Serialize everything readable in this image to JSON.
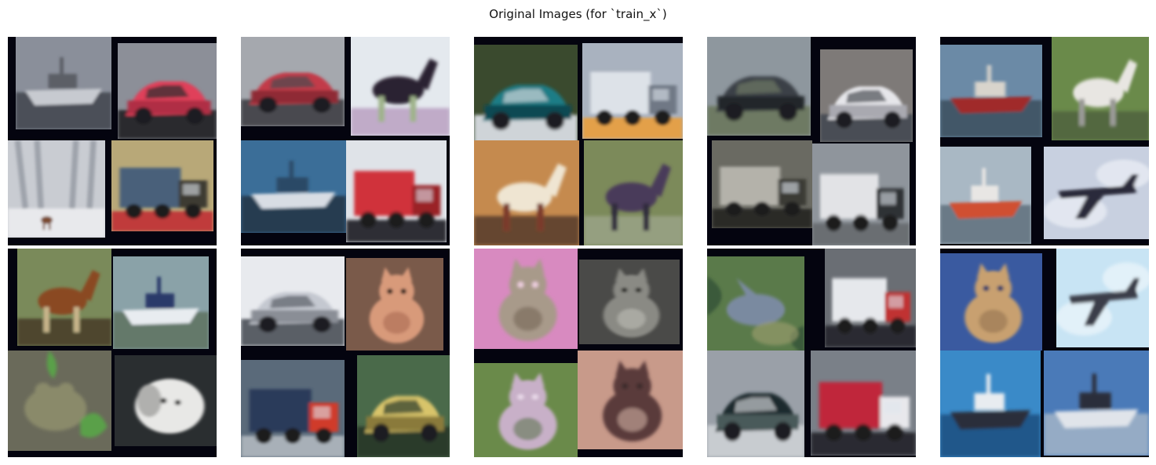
{
  "title": "Original Images (for `train_x`)",
  "grid": {
    "rows": 2,
    "cols": 5
  },
  "mosaics": [
    {
      "name": "mosaic-r1-c1",
      "tiles": [
        {
          "name": "tile-boats-shore",
          "icon": "boat-icon",
          "colors": {
            "bg": "#8a8f9a",
            "a": "#c7cad0",
            "b": "#5b5f66",
            "c": "#3b3f48"
          }
        },
        {
          "name": "tile-red-car",
          "icon": "car-icon",
          "colors": {
            "bg": "#8c8f98",
            "a": "#e0405a",
            "b": "#b02e44",
            "c": "#2a2a2e"
          }
        },
        {
          "name": "tile-deer-snow",
          "icon": "deer-icon",
          "colors": {
            "bg": "#c9ccd2",
            "a": "#9ea3ab",
            "b": "#7a4a2e",
            "c": "#e8e9ec"
          }
        },
        {
          "name": "tile-truck-road",
          "icon": "truck-icon",
          "colors": {
            "bg": "#b8a878",
            "a": "#49617a",
            "b": "#3e3a30",
            "c": "#c03a3a"
          }
        }
      ]
    },
    {
      "name": "mosaic-r1-c2",
      "tiles": [
        {
          "name": "tile-red-car-street",
          "icon": "car-icon",
          "colors": {
            "bg": "#a5a8ae",
            "a": "#c23a48",
            "b": "#8f2a36",
            "c": "#4a4a50"
          }
        },
        {
          "name": "tile-horse-rider",
          "icon": "horse-icon",
          "colors": {
            "bg": "#e4e9ee",
            "a": "#2a2230",
            "b": "#9fb38a",
            "c": "#b090b8"
          }
        },
        {
          "name": "tile-boat-sea",
          "icon": "boat-icon",
          "colors": {
            "bg": "#3b6e98",
            "a": "#d8dde4",
            "b": "#2a4a66",
            "c": "#1e2e3e"
          }
        },
        {
          "name": "tile-fire-truck",
          "icon": "truck-icon",
          "colors": {
            "bg": "#dfe3e8",
            "a": "#d0303a",
            "b": "#9a2026",
            "c": "#2e2e34"
          }
        }
      ]
    },
    {
      "name": "mosaic-r1-c3",
      "tiles": [
        {
          "name": "tile-teal-car",
          "icon": "car-icon",
          "colors": {
            "bg": "#3a4a2e",
            "a": "#1f7d86",
            "b": "#0f4a52",
            "c": "#cfd4d8"
          }
        },
        {
          "name": "tile-truck-closeup",
          "icon": "truck-icon",
          "colors": {
            "bg": "#a9b2bf",
            "a": "#dde2e8",
            "b": "#6f7885",
            "c": "#e3a04a"
          }
        },
        {
          "name": "tile-horse-head",
          "icon": "horse-icon",
          "colors": {
            "bg": "#c58a4e",
            "a": "#efe5d2",
            "b": "#7a3a2a",
            "c": "#3a2a24"
          }
        },
        {
          "name": "tile-dark-horse",
          "icon": "horse-icon",
          "colors": {
            "bg": "#7c8a5a",
            "a": "#4a3a5a",
            "b": "#2e2a3a",
            "c": "#a0a890"
          }
        }
      ]
    },
    {
      "name": "mosaic-r1-c4",
      "tiles": [
        {
          "name": "tile-dark-car",
          "icon": "car-icon",
          "colors": {
            "bg": "#8e979e",
            "a": "#3a3f46",
            "b": "#22252a",
            "c": "#6e7a64"
          }
        },
        {
          "name": "tile-white-car",
          "icon": "car-icon",
          "colors": {
            "bg": "#7e7a78",
            "a": "#e6e6ea",
            "b": "#a9a9b0",
            "c": "#4a4e54"
          }
        },
        {
          "name": "tile-tanker-truck",
          "icon": "truck-icon",
          "colors": {
            "bg": "#6a6a62",
            "a": "#b4b2aa",
            "b": "#3a3a36",
            "c": "#2a2a28"
          }
        },
        {
          "name": "tile-trailer",
          "icon": "trailer-icon",
          "colors": {
            "bg": "#8f959c",
            "a": "#e2e3e6",
            "b": "#2e3034",
            "c": "#6a6e72"
          }
        }
      ]
    },
    {
      "name": "mosaic-r1-c5",
      "tiles": [
        {
          "name": "tile-tug-harbor",
          "icon": "boat-icon",
          "colors": {
            "bg": "#6b8aa6",
            "a": "#a02a2a",
            "b": "#d8d4cc",
            "c": "#3a4a58"
          }
        },
        {
          "name": "tile-white-horse",
          "icon": "horse-icon",
          "colors": {
            "bg": "#6a8a4a",
            "a": "#e8e6e2",
            "b": "#9a9a96",
            "c": "#4a5a3a"
          }
        },
        {
          "name": "tile-red-boat",
          "icon": "boat-icon",
          "colors": {
            "bg": "#a9b8c4",
            "a": "#d05030",
            "b": "#e8e6e4",
            "c": "#5a6a78"
          }
        },
        {
          "name": "tile-airplane-sky",
          "icon": "airplane-icon",
          "colors": {
            "bg": "#c8d0e0",
            "a": "#2a2c3a",
            "b": "#e8ecf4",
            "c": "#7a8aa8"
          }
        }
      ]
    },
    {
      "name": "mosaic-r2-c1",
      "tiles": [
        {
          "name": "tile-brown-horse",
          "icon": "horse-icon",
          "colors": {
            "bg": "#7a8a5a",
            "a": "#8a4a24",
            "b": "#c8b48a",
            "c": "#3a2a1e"
          }
        },
        {
          "name": "tile-white-yacht",
          "icon": "boat-icon",
          "colors": {
            "bg": "#8aa2a8",
            "a": "#e8ecf0",
            "b": "#2a3a6a",
            "c": "#5a6e5a"
          }
        },
        {
          "name": "tile-frog",
          "icon": "frog-icon",
          "colors": {
            "bg": "#6a6a5a",
            "a": "#8a8a6a",
            "b": "#5aa04a",
            "c": "#3a3a2e"
          }
        },
        {
          "name": "tile-white-dog",
          "icon": "dog-icon",
          "colors": {
            "bg": "#2a2e30",
            "a": "#e8e8e6",
            "b": "#b0b0ae",
            "c": "#1a1c1e"
          }
        }
      ]
    },
    {
      "name": "mosaic-r2-c2",
      "tiles": [
        {
          "name": "tile-white-van",
          "icon": "car-icon",
          "colors": {
            "bg": "#e8eaee",
            "a": "#c4c8d0",
            "b": "#8a8e96",
            "c": "#5a5e66"
          }
        },
        {
          "name": "tile-orange-cat",
          "icon": "cat-icon",
          "colors": {
            "bg": "#7a5a4a",
            "a": "#d89a7a",
            "b": "#a0604a",
            "c": "#3a2a24"
          }
        },
        {
          "name": "tile-blue-truck",
          "icon": "truck-icon",
          "colors": {
            "bg": "#5a6a7a",
            "a": "#2a3a5a",
            "b": "#d03a2a",
            "c": "#a8b0b8"
          }
        },
        {
          "name": "tile-yellow-car",
          "icon": "car-icon",
          "colors": {
            "bg": "#4a6a4a",
            "a": "#d8c46a",
            "b": "#8a7a3a",
            "c": "#2a3a2a"
          }
        }
      ]
    },
    {
      "name": "mosaic-r2-c3",
      "tiles": [
        {
          "name": "tile-cat-pink",
          "icon": "cat-icon",
          "colors": {
            "bg": "#d88ac0",
            "a": "#a89a8a",
            "b": "#6a5a4a",
            "c": "#f0d0e0"
          }
        },
        {
          "name": "tile-gray-cat",
          "icon": "cat-icon",
          "colors": {
            "bg": "#4a4a48",
            "a": "#8a8a84",
            "b": "#c8c8c0",
            "c": "#2a2a28"
          }
        },
        {
          "name": "tile-cat-grass",
          "icon": "cat-icon",
          "colors": {
            "bg": "#6a8a4a",
            "a": "#c8b0c8",
            "b": "#4a6a3a",
            "c": "#e8d8e8"
          }
        },
        {
          "name": "tile-cat-hand",
          "icon": "cat-icon",
          "colors": {
            "bg": "#c89a8a",
            "a": "#5a3a3a",
            "b": "#e8c8b8",
            "c": "#3a2a2a"
          }
        }
      ]
    },
    {
      "name": "mosaic-r2-c4",
      "tiles": [
        {
          "name": "tile-bird-leaves",
          "icon": "bird-icon",
          "colors": {
            "bg": "#5a7a4a",
            "a": "#7a8aa0",
            "b": "#3a5a3a",
            "c": "#a0a070"
          }
        },
        {
          "name": "tile-ambulance",
          "icon": "truck-icon",
          "colors": {
            "bg": "#6a6e74",
            "a": "#e6e8ec",
            "b": "#c03030",
            "c": "#2a2c30"
          }
        },
        {
          "name": "tile-black-car",
          "icon": "car-icon",
          "colors": {
            "bg": "#9aa0a8",
            "a": "#1e2a2e",
            "b": "#4a5a5a",
            "c": "#c8ccd0"
          }
        },
        {
          "name": "tile-fire-engine",
          "icon": "truck-icon",
          "colors": {
            "bg": "#7a8088",
            "a": "#c0283a",
            "b": "#e8e8ec",
            "c": "#2a2c30"
          }
        }
      ]
    },
    {
      "name": "mosaic-r2-c5",
      "tiles": [
        {
          "name": "tile-cat-blue",
          "icon": "cat-icon",
          "colors": {
            "bg": "#3a5aa0",
            "a": "#c8a070",
            "b": "#8a6a4a",
            "c": "#2a3a6a"
          }
        },
        {
          "name": "tile-airplane-blue",
          "icon": "airplane-icon",
          "colors": {
            "bg": "#c8e4f4",
            "a": "#3a3e48",
            "b": "#e8f4fa",
            "c": "#6a7a8a"
          }
        },
        {
          "name": "tile-blue-boat",
          "icon": "boat-icon",
          "colors": {
            "bg": "#3a8ac8",
            "a": "#2a2e3a",
            "b": "#e8ecf0",
            "c": "#1a4a7a"
          }
        },
        {
          "name": "tile-ferry",
          "icon": "boat-icon",
          "colors": {
            "bg": "#4a7ab8",
            "a": "#e0e4ea",
            "b": "#2a2e3a",
            "c": "#a8b8c8"
          }
        }
      ]
    }
  ]
}
